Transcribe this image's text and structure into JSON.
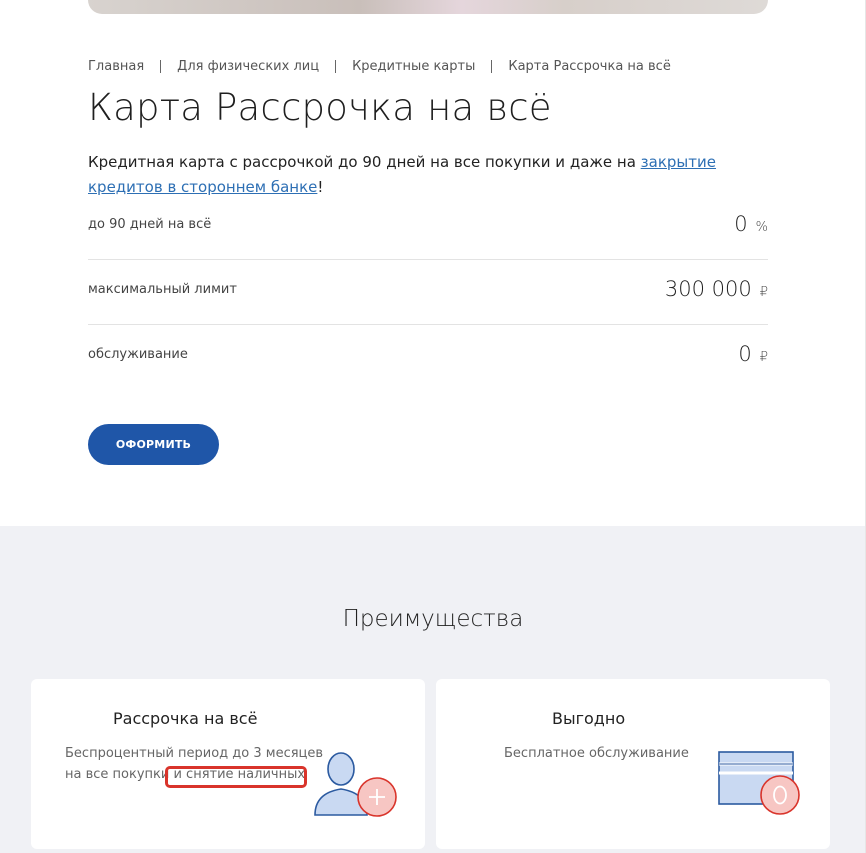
{
  "breadcrumb": [
    {
      "label": "Главная"
    },
    {
      "label": "Для физических лиц"
    },
    {
      "label": "Кредитные карты"
    },
    {
      "label": "Карта Рассрочка на всё"
    }
  ],
  "page_title": "Карта Рассрочка на всё",
  "intro": {
    "text_before": "Кредитная карта с рассрочкой до 90 дней на все покупки и даже на ",
    "link_text": "закрытие кредитов в стороннем банке",
    "text_after": "!"
  },
  "params": [
    {
      "label": "до 90 дней на всё",
      "value": "0",
      "unit": "%"
    },
    {
      "label": "максимальный лимит",
      "value": "300 000",
      "unit": "₽"
    },
    {
      "label": "обслуживание",
      "value": "0",
      "unit": "₽"
    }
  ],
  "apply_button": "ОФОРМИТЬ",
  "advantages": {
    "title": "Преимущества",
    "cards": [
      {
        "title": "Рассрочка на всё",
        "line1": "Беспроцентный период до 3 месяцев",
        "line2_before": "на все покупки ",
        "line2_highlight": "и снятие наличных",
        "icon": "user-plus-icon"
      },
      {
        "title": "Выгодно",
        "line1": "Бесплатное обслуживание",
        "icon": "card-zero-icon"
      }
    ]
  },
  "colors": {
    "accent": "#1f56a8",
    "link": "#2d6fb4",
    "highlight": "#d9342b",
    "section_bg": "#f0f1f5"
  }
}
